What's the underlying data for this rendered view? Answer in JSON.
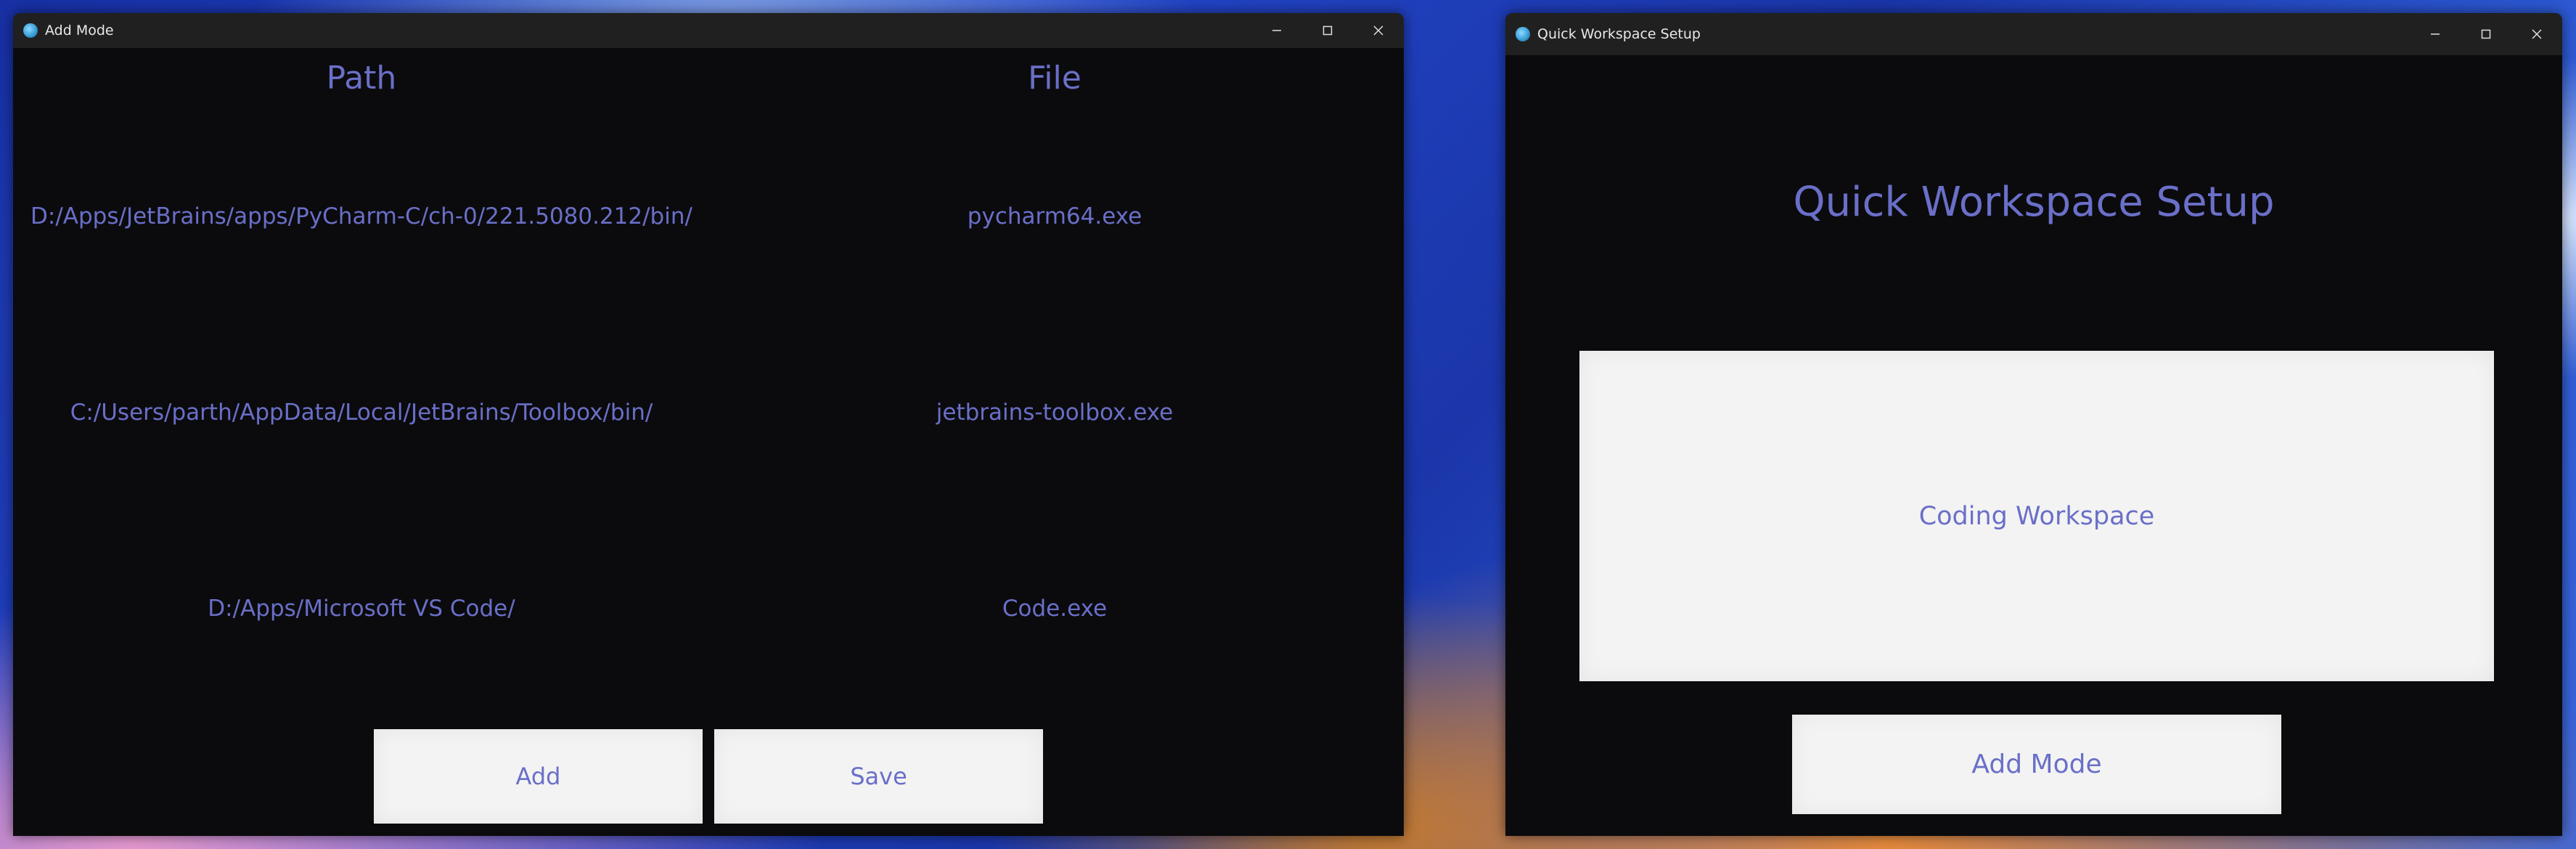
{
  "add_mode_window": {
    "title": "Add Mode",
    "columns": {
      "path": "Path",
      "file": "File"
    },
    "rows": [
      {
        "path": "D:/Apps/JetBrains/apps/PyCharm-C/ch-0/221.5080.212/bin/",
        "file": "pycharm64.exe"
      },
      {
        "path": "C:/Users/parth/AppData/Local/JetBrains/Toolbox/bin/",
        "file": "jetbrains-toolbox.exe"
      },
      {
        "path": "D:/Apps/Microsoft VS Code/",
        "file": "Code.exe"
      }
    ],
    "buttons": {
      "add": "Add",
      "save": "Save"
    }
  },
  "workspace_window": {
    "title": "Quick Workspace Setup",
    "heading": "Quick Workspace Setup",
    "workspace_button": "Coding Workspace",
    "add_mode_button": "Add Mode"
  },
  "colors": {
    "window_bg": "#0b0b0d",
    "titlebar_bg": "#202020",
    "accent_text": "#6a6fc8",
    "button_bg": "#f3f3f3"
  },
  "icons": [
    "app-icon",
    "minimize-icon",
    "maximize-icon",
    "close-icon"
  ]
}
